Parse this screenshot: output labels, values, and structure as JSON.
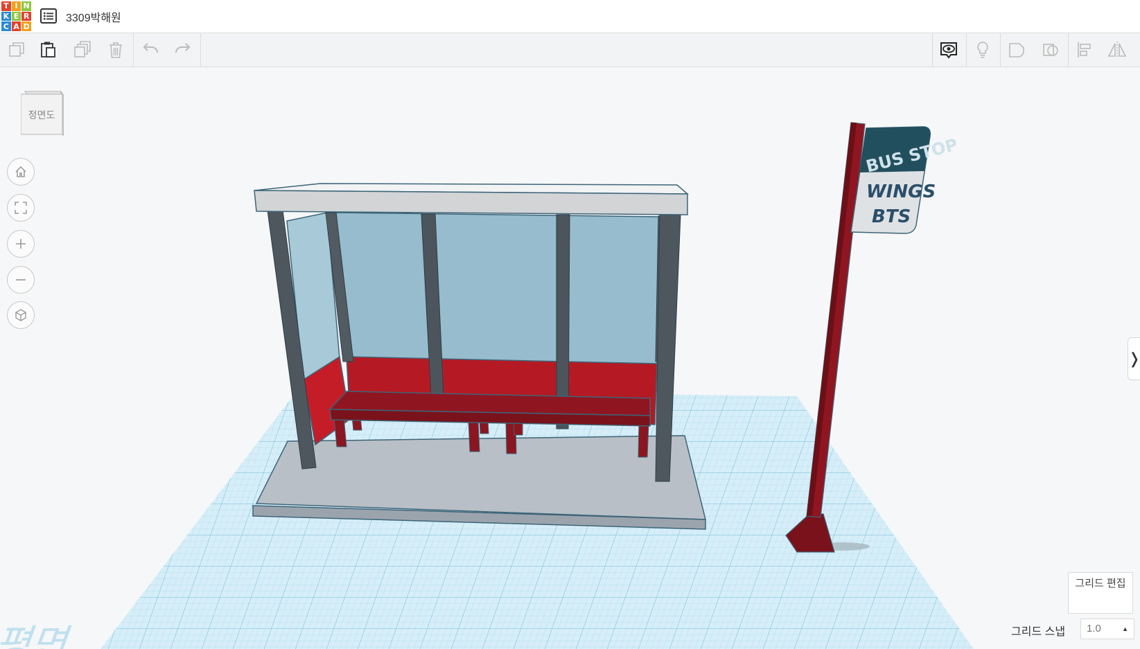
{
  "app": {
    "logo_letters": [
      "T",
      "I",
      "N",
      "K",
      "E",
      "R",
      "C",
      "A",
      "D"
    ],
    "logo_colors": [
      "#e3412b",
      "#f2a01e",
      "#8dc63f",
      "#2a8ad4",
      "#8dc63f",
      "#e3412b",
      "#2a8ad4",
      "#e3412b",
      "#f2a01e"
    ],
    "project_title": "3309박해원"
  },
  "toolbar": {
    "left": [
      "copy-icon",
      "paste-icon",
      "duplicate-icon",
      "delete-icon",
      "undo-icon",
      "redo-icon"
    ],
    "right": [
      "show-all-icon",
      "lightbulb-icon",
      "group-icon",
      "ungroup-icon",
      "align-icon",
      "mirror-icon"
    ]
  },
  "viewcube": {
    "label": "정면도"
  },
  "nav_controls": [
    "home-view",
    "fit-all",
    "zoom-in",
    "zoom-out",
    "orthographic-view"
  ],
  "scene": {
    "sign_text_top": "BUS STOP",
    "sign_text_line1": "WINGS",
    "sign_text_line2": "BTS",
    "workplane_label": "작업 평면"
  },
  "grid": {
    "edit_label": "그리드 편집",
    "snap_label": "그리드 스냅",
    "snap_value": "1.0"
  },
  "colors": {
    "accent_blue": "#2a8ad4",
    "grid_line": "#86c5e0",
    "shelter_red": "#b51a24",
    "glass": "#97bccd"
  }
}
